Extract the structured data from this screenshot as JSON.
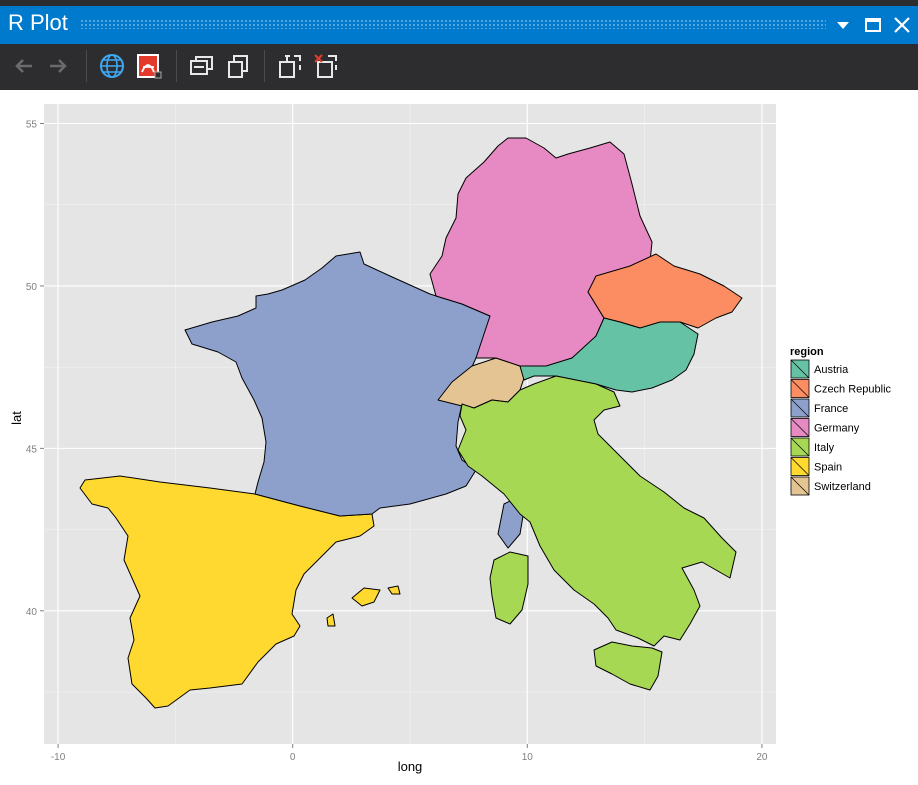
{
  "window": {
    "title": "R Plot",
    "buttons": [
      "chevron-down",
      "maximize",
      "close"
    ]
  },
  "toolbar": {
    "items": [
      "back-arrow",
      "forward-arrow",
      "globe",
      "pdf-export",
      "copy-window",
      "copy-plot",
      "zoom-plot",
      "remove-plot"
    ]
  },
  "colors": {
    "titlebar": "#007acc",
    "toolbar": "#2d2d30",
    "panel": "#e5e5e5"
  },
  "chart_data": {
    "type": "map",
    "xlabel": "long",
    "ylabel": "lat",
    "xlim": [
      -10.6,
      20.6
    ],
    "ylim": [
      35.9,
      55.6
    ],
    "xticks": [
      -10,
      0,
      10,
      20
    ],
    "yticks": [
      40,
      45,
      50,
      55
    ],
    "grid": true,
    "legend_title": "region",
    "legend_position": "right",
    "regions": [
      {
        "name": "Austria",
        "color": "#66c2a5"
      },
      {
        "name": "Czech Republic",
        "color": "#fc8d62"
      },
      {
        "name": "France",
        "color": "#8da0cb"
      },
      {
        "name": "Germany",
        "color": "#e78ac3"
      },
      {
        "name": "Italy",
        "color": "#a6d854"
      },
      {
        "name": "Spain",
        "color": "#ffd92f"
      },
      {
        "name": "Switzerland",
        "color": "#e5c494"
      }
    ]
  }
}
